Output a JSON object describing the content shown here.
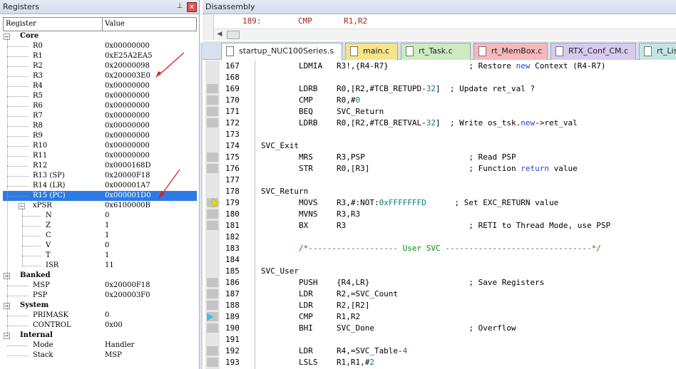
{
  "registers_pane": {
    "title": "Registers",
    "pin_icon": "pushpin-icon",
    "close_icon": "close-icon",
    "col_register": "Register",
    "col_value": "Value"
  },
  "registers": [
    {
      "name": "Core",
      "value": "",
      "level": 0,
      "group": true
    },
    {
      "name": "R0",
      "value": "0x00000000",
      "level": 1
    },
    {
      "name": "R1",
      "value": "0xE25A2EA5",
      "level": 1
    },
    {
      "name": "R2",
      "value": "0x20000098",
      "level": 1
    },
    {
      "name": "R3",
      "value": "0x200003E0",
      "level": 1
    },
    {
      "name": "R4",
      "value": "0x00000000",
      "level": 1
    },
    {
      "name": "R5",
      "value": "0x00000000",
      "level": 1
    },
    {
      "name": "R6",
      "value": "0x00000000",
      "level": 1
    },
    {
      "name": "R7",
      "value": "0x00000000",
      "level": 1
    },
    {
      "name": "R8",
      "value": "0x00000000",
      "level": 1
    },
    {
      "name": "R9",
      "value": "0x00000000",
      "level": 1
    },
    {
      "name": "R10",
      "value": "0x00000000",
      "level": 1
    },
    {
      "name": "R11",
      "value": "0x00000000",
      "level": 1
    },
    {
      "name": "R12",
      "value": "0x0000168D",
      "level": 1
    },
    {
      "name": "R13 (SP)",
      "value": "0x20000F18",
      "level": 1
    },
    {
      "name": "R14 (LR)",
      "value": "0x000001A7",
      "level": 1
    },
    {
      "name": "R15 (PC)",
      "value": "0x000001D0",
      "level": 1,
      "selected": true
    },
    {
      "name": "xPSR",
      "value": "0x6100000B",
      "level": 1,
      "expander": true
    },
    {
      "name": "N",
      "value": "0",
      "level": 2
    },
    {
      "name": "Z",
      "value": "1",
      "level": 2
    },
    {
      "name": "C",
      "value": "1",
      "level": 2
    },
    {
      "name": "V",
      "value": "0",
      "level": 2
    },
    {
      "name": "T",
      "value": "1",
      "level": 2
    },
    {
      "name": "ISR",
      "value": "11",
      "level": 2
    },
    {
      "name": "Banked",
      "value": "",
      "level": 0,
      "group": true
    },
    {
      "name": "MSP",
      "value": "0x20000F18",
      "level": 1
    },
    {
      "name": "PSP",
      "value": "0x200003F0",
      "level": 1
    },
    {
      "name": "System",
      "value": "",
      "level": 0,
      "group": true
    },
    {
      "name": "PRIMASK",
      "value": "0",
      "level": 1
    },
    {
      "name": "CONTROL",
      "value": "0x00",
      "level": 1
    },
    {
      "name": "Internal",
      "value": "",
      "level": 0,
      "group": true
    },
    {
      "name": "Mode",
      "value": "Handler",
      "level": 1
    },
    {
      "name": "Stack",
      "value": "MSP",
      "level": 1
    }
  ],
  "disassembly": {
    "title": "Disassembly",
    "line_no": "189:",
    "mnemonic": "CMP",
    "operands": "R1,R2"
  },
  "tabs": [
    {
      "label": "startup_NUC100Series.s",
      "color": "#dce8f7",
      "active": true
    },
    {
      "label": "main.c",
      "color": "#f7e38a"
    },
    {
      "label": "rt_Task.c",
      "color": "#cdeac0"
    },
    {
      "label": "rt_MemBox.c",
      "color": "#f7b8bc"
    },
    {
      "label": "RTX_Conf_CM.c",
      "color": "#d8c9ef"
    },
    {
      "label": "rt_List.c",
      "color": "#c4e6e3"
    }
  ],
  "code_lines": [
    {
      "n": "167",
      "t": "        LDMIA   R3!,{R4-R7}                 ; Restore <kw>new</kw> Context (R4-R7)"
    },
    {
      "n": "168",
      "t": ""
    },
    {
      "n": "169",
      "t": "        LDRB    R0,[R2,#TCB_RETUPD-<num>32</num>]  ; Update ret_val ?"
    },
    {
      "n": "170",
      "t": "        CMP     R0,#<num>0</num>"
    },
    {
      "n": "171",
      "t": "        BEQ     SVC_Return"
    },
    {
      "n": "172",
      "t": "        LDRB    R0,[R2,#TCB_RETVAL-<num>32</num>]  ; Write os_tsk.<kw>new</kw>-&gt;ret_val"
    },
    {
      "n": "173",
      "t": ""
    },
    {
      "n": "174",
      "t": "SVC_Exit"
    },
    {
      "n": "175",
      "t": "        MRS     R3,PSP                      ; Read PSP"
    },
    {
      "n": "176",
      "t": "        STR     R0,[R3]                     ; Function <kw>return</kw> value"
    },
    {
      "n": "177",
      "t": ""
    },
    {
      "n": "178",
      "t": "SVC_Return"
    },
    {
      "n": "179",
      "t": "        MOVS    R3,#:NOT:<num>0xFFFFFFFD</num>      ; Set EXC_RETURN value"
    },
    {
      "n": "180",
      "t": "        MVNS    R3,R3"
    },
    {
      "n": "181",
      "t": "        BX      R3                          ; RETI to Thread Mode, use PSP"
    },
    {
      "n": "182",
      "t": ""
    },
    {
      "n": "183",
      "t": "        <cm>/*------------------- User SVC -------------------------------*/</cm>"
    },
    {
      "n": "184",
      "t": ""
    },
    {
      "n": "185",
      "t": "SVC_User"
    },
    {
      "n": "186",
      "t": "        PUSH    {R4,LR}                     ; Save Registers"
    },
    {
      "n": "187",
      "t": "        LDR     R2,=SVC_Count"
    },
    {
      "n": "188",
      "t": "        LDR     R2,[R2]"
    },
    {
      "n": "189",
      "t": "        CMP     R1,R2"
    },
    {
      "n": "190",
      "t": "        BHI     SVC_Done                    ; Overflow"
    },
    {
      "n": "191",
      "t": ""
    },
    {
      "n": "192",
      "t": "        LDR     R4,=SVC_Table-<num>4</num>"
    },
    {
      "n": "193",
      "t": "        LSLS    R1,R1,#<num>2</num>"
    }
  ],
  "markers": {
    "current_instruction_icon": "yellow-arrow-icon",
    "caller_icon": "cyan-arrow-icon",
    "annotation_arrow_icon": "red-arrow-icon"
  }
}
